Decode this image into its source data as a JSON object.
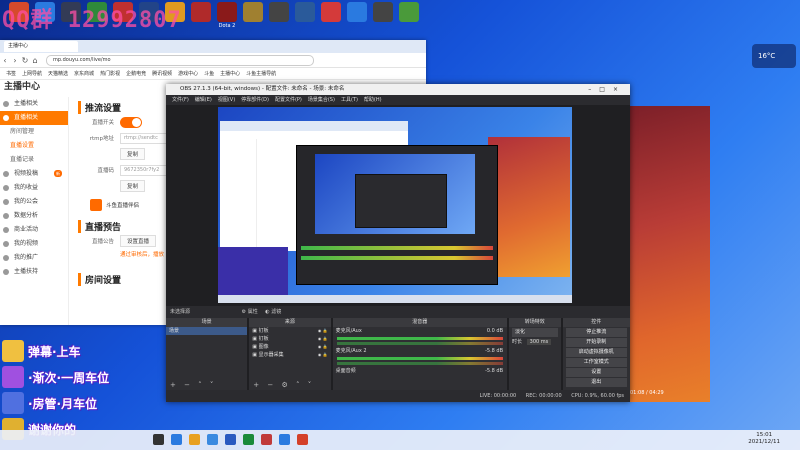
{
  "overlay": {
    "watermark": "QQ群 12992807"
  },
  "desktop_icons": [
    {
      "label": "",
      "color": "#d64a2c"
    },
    {
      "label": "",
      "color": "#2a7ae0"
    },
    {
      "label": "",
      "color": "#333b56"
    },
    {
      "label": "",
      "color": "#2f8a3a"
    },
    {
      "label": "",
      "color": "#c03030"
    },
    {
      "label": "",
      "color": "#224488"
    },
    {
      "label": "",
      "color": "#e09a20"
    },
    {
      "label": "",
      "color": "#b02a2a"
    },
    {
      "label": "Dota 2",
      "color": "#8a1a1a"
    },
    {
      "label": "",
      "color": "#a08030"
    },
    {
      "label": "",
      "color": "#444"
    },
    {
      "label": "",
      "color": "#2a5a9a"
    },
    {
      "label": "",
      "color": "#d43a3a"
    },
    {
      "label": "",
      "color": "#2a7ae0"
    },
    {
      "label": "",
      "color": "#444444"
    },
    {
      "label": "",
      "color": "#4a9a3a"
    }
  ],
  "browser": {
    "tab": "主播中心",
    "url": "mp.douyu.com/live/mo",
    "bookmarks": [
      "书签",
      "上网导航",
      "天猫精选",
      "京东商城",
      "热门影视",
      "企鹅电竞",
      "腾讯视频",
      "游戏中心",
      "斗鱼",
      "主播中心",
      "斗鱼主播导航"
    ],
    "site_title": "主播中心",
    "sidebar": {
      "items": [
        {
          "label": "主播相关",
          "kind": "item"
        },
        {
          "label": "直播相关",
          "kind": "active"
        },
        {
          "label": "房间管理",
          "kind": "sub"
        },
        {
          "label": "直播设置",
          "kind": "subactive"
        },
        {
          "label": "直播记录",
          "kind": "sub"
        },
        {
          "label": "视频投稿",
          "kind": "item",
          "badge": "新"
        },
        {
          "label": "我的收益",
          "kind": "item"
        },
        {
          "label": "我的公会",
          "kind": "item"
        },
        {
          "label": "数据分析",
          "kind": "item"
        },
        {
          "label": "商业活动",
          "kind": "item"
        },
        {
          "label": "我的视频",
          "kind": "item"
        },
        {
          "label": "我的推广",
          "kind": "item"
        },
        {
          "label": "主播扶持",
          "kind": "item"
        }
      ]
    },
    "main": {
      "section1": "推流设置",
      "live_switch_label": "直播开关",
      "rtmp_label": "rtmp地址",
      "rtmp_value": "rtmp://sendtc",
      "copy_btn": "复制",
      "code_label": "直播码",
      "code_value": "9672350r7fy2",
      "promo": "斗鱼直播伴侣",
      "section2": "直播预告",
      "notice_label": "直播公告",
      "notice_btn": "设置直播",
      "notice_hint": "通过审核后，播放",
      "section3": "房间设置"
    }
  },
  "obs": {
    "title": "OBS 27.1.3 (64-bit, windows) - 配置文件: 未命名 - 场景: 未命名",
    "menu": [
      "文件(F)",
      "编辑(E)",
      "视图(V)",
      "停靠部件(D)",
      "配置文件(P)",
      "场景集合(S)",
      "工具(T)",
      "帮助(H)"
    ],
    "source_bar": {
      "label": "未选择源",
      "props": "属性",
      "filters": "滤镜"
    },
    "docks": {
      "scenes": {
        "header": "场景",
        "items": [
          "场景"
        ]
      },
      "sources": {
        "header": "来源",
        "items": [
          "钉板",
          "钉板",
          "图像",
          "显示器采集"
        ]
      },
      "mixer": {
        "header": "混音器",
        "ch1": "麦克风/Aux",
        "ch1_db": "0.0 dB",
        "ch2": "麦克风/Aux 2",
        "ch2_db": "-5.8 dB",
        "ch3": "桌面音频",
        "ch3_db": "-5.8 dB"
      },
      "transitions": {
        "header": "转场特效",
        "type": "淡化",
        "dur_label": "时长",
        "dur_value": "300 ms"
      },
      "controls": {
        "header": "控件",
        "buttons": [
          "停止推流",
          "开始录制",
          "启动虚拟摄像机",
          "工作室模式",
          "设置",
          "退出"
        ]
      }
    },
    "status": {
      "live": "LIVE: 00:00:00",
      "rec": "REC: 00:00:00",
      "cpu": "CPU: 0.9%, 60.00 fps"
    }
  },
  "weather": {
    "temp": "16°C"
  },
  "redapp": {
    "footer": "01:08 / 04:29"
  },
  "chat": [
    {
      "text": "弹幕·上车",
      "color": "#f0c040"
    },
    {
      "text": "·渐次·一周车位",
      "color": "#a050e0"
    },
    {
      "text": "·房管·月车位",
      "color": "#5070e0"
    },
    {
      "text": "谢谢你的",
      "color": "#e0b030"
    }
  ],
  "taskbar": {
    "time": "15:01",
    "date": "2021/12/11",
    "apps": [
      "#333",
      "#2a7ae0",
      "#e8a020",
      "#3a8ae0",
      "#2a5ac0",
      "#1a8a3a",
      "#c03a3a",
      "#2a7ae0",
      "#d4402a"
    ]
  }
}
